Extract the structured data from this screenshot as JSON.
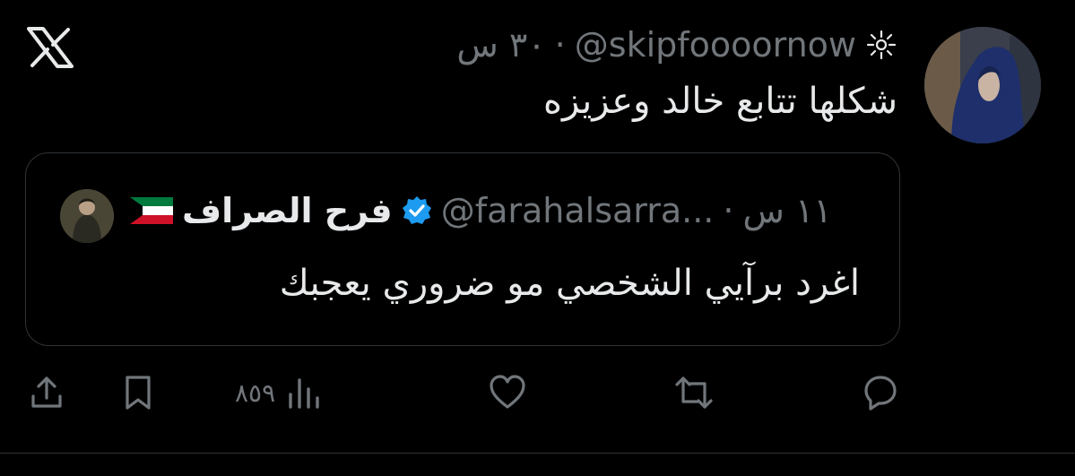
{
  "tweet": {
    "handle": "@skipfoooornow",
    "separator": "·",
    "time": "٣٠ س",
    "text": "شكلها تتابع خالد وعزيزه"
  },
  "quoted": {
    "name": "فرح الصراف",
    "handle": "@farahalsarra...",
    "separator": "·",
    "time": "١١ س",
    "text": "اغرد برآيي الشخصي مو ضروري يعجبك"
  },
  "actions": {
    "views": "٨٥٩"
  },
  "colors": {
    "background": "#000000",
    "text": "#e7e9ea",
    "muted": "#71767b",
    "border": "#2f3336",
    "verified": "#1d9bf0"
  },
  "icons": [
    "x-logo-icon",
    "sparkle-icon",
    "verified-badge-icon",
    "kuwait-flag-icon",
    "reply-icon",
    "retweet-icon",
    "like-icon",
    "views-icon",
    "bookmark-icon",
    "share-icon"
  ]
}
